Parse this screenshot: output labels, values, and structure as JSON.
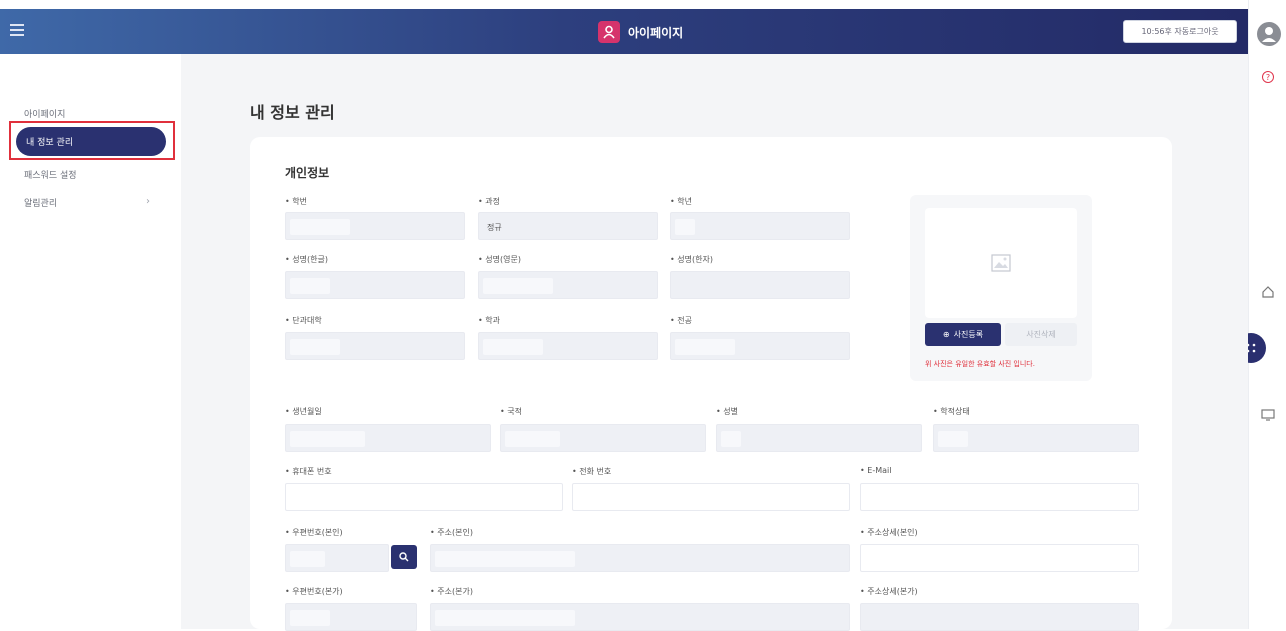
{
  "header": {
    "title": "아이페이지",
    "auto_logout_label": "10:56후 자동로그아웃",
    "brand_color": "#d6336c"
  },
  "sidebar": {
    "items": [
      {
        "label": "아이페이지"
      },
      {
        "label": "내 정보 관리",
        "active": true
      },
      {
        "label": "패스워드 설정"
      },
      {
        "label": "알림관리"
      }
    ]
  },
  "main": {
    "page_title": "내 정보 관리",
    "section_title": "개인정보",
    "fields": {
      "student_id": {
        "label": "• 학번",
        "value": ""
      },
      "course": {
        "label": "• 과정",
        "value": "정규"
      },
      "grade": {
        "label": "• 학년",
        "value": ""
      },
      "name_kr": {
        "label": "• 성명(한글)",
        "value": ""
      },
      "name_en": {
        "label": "• 성명(영문)",
        "value": ""
      },
      "name_hanja": {
        "label": "• 성명(한자)",
        "value": ""
      },
      "college": {
        "label": "• 단과대학",
        "value": ""
      },
      "department": {
        "label": "• 학과",
        "value": ""
      },
      "major": {
        "label": "• 전공",
        "value": ""
      },
      "birth": {
        "label": "• 생년월일",
        "value": ""
      },
      "nationality": {
        "label": "• 국적",
        "value": ""
      },
      "gender": {
        "label": "• 성별",
        "value": ""
      },
      "status": {
        "label": "• 학적상태",
        "value": ""
      },
      "mobile": {
        "label": "• 휴대폰 번호",
        "value": ""
      },
      "phone": {
        "label": "• 전화 번호",
        "value": ""
      },
      "email": {
        "label": "• E-Mail",
        "value": ""
      },
      "zip_home": {
        "label": "• 우편번호(본인)",
        "value": ""
      },
      "addr_home": {
        "label": "• 주소(본인)",
        "value": ""
      },
      "addr_home_detail": {
        "label": "• 주소상세(본인)",
        "value": ""
      },
      "zip_parent": {
        "label": "• 우편번호(본가)",
        "value": ""
      },
      "addr_parent": {
        "label": "• 주소(본가)",
        "value": ""
      },
      "addr_parent_detail": {
        "label": "• 주소상세(본가)",
        "value": ""
      }
    },
    "photo": {
      "upload_label": "사진등록",
      "delete_label": "사진삭제",
      "note": "위 사진은 유일한 유효할 사진 입니다."
    }
  },
  "colors": {
    "nav_dark": "#2a3170",
    "accent_red": "#e0303c"
  }
}
